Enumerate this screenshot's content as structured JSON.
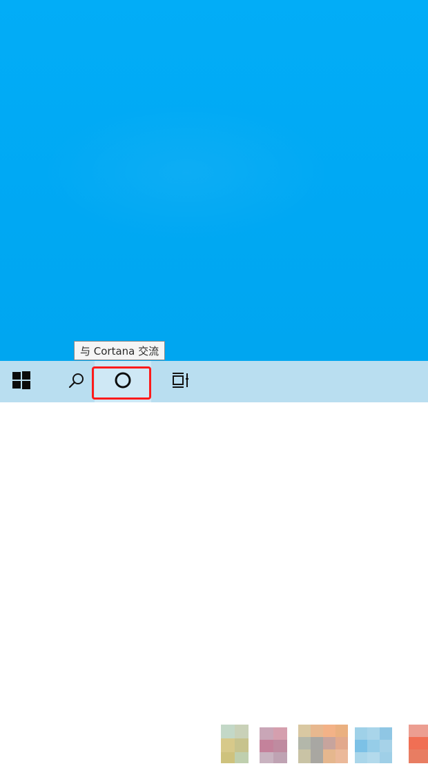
{
  "tooltip": {
    "text": "与 Cortana 交流"
  },
  "taskbar": {
    "start_icon": "windows-logo-icon",
    "search_icon": "search-icon",
    "cortana_icon": "cortana-ring-icon",
    "taskview_icon": "task-view-icon",
    "highlight_color": "#ff1a1a"
  },
  "colors": {
    "desktop": "#00aaf5",
    "taskbar": "#b9def0",
    "tooltip_bg": "#f5f5f5"
  }
}
